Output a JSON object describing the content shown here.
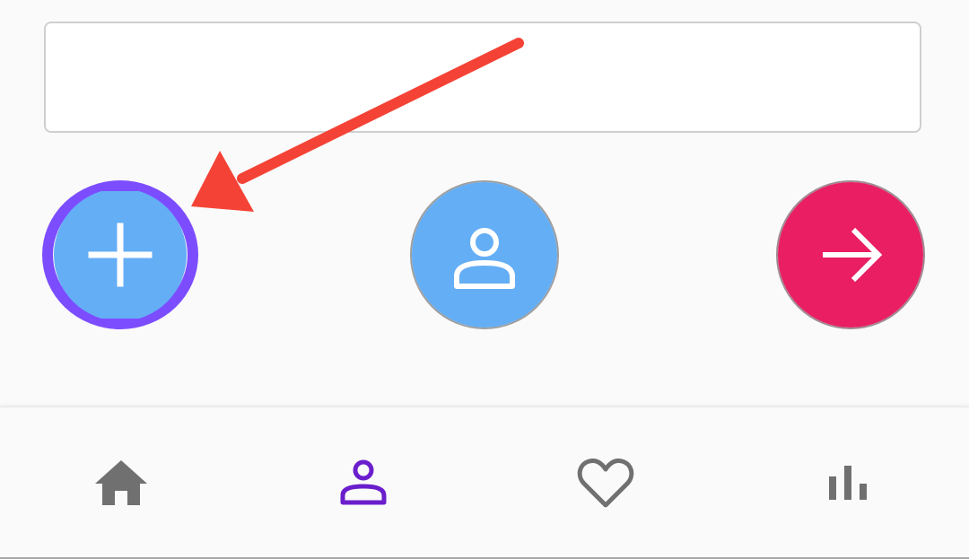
{
  "input": {
    "value": "",
    "placeholder": ""
  },
  "fabs": {
    "add": {
      "icon": "plus-icon",
      "fill": "#64aef5",
      "ring": "#7c4dff"
    },
    "person": {
      "icon": "person-icon",
      "fill": "#64aef5"
    },
    "next": {
      "icon": "arrow-right-icon",
      "fill": "#e91e63"
    }
  },
  "annotation": {
    "color": "#f44336"
  },
  "bottom_nav": {
    "items": [
      {
        "icon": "home-icon",
        "color": "#707070",
        "selected": false
      },
      {
        "icon": "person-icon",
        "color": "#6a1ecc",
        "selected": true
      },
      {
        "icon": "heart-icon",
        "color": "#707070",
        "selected": false
      },
      {
        "icon": "bar-chart-icon",
        "color": "#707070",
        "selected": false
      }
    ]
  }
}
